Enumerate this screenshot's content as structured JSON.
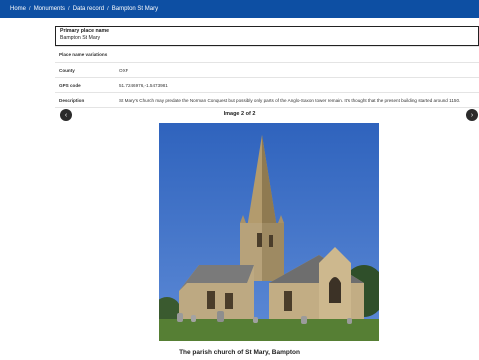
{
  "breadcrumb": {
    "items": [
      "Home",
      "Monuments",
      "Data record",
      "Bampton St Mary"
    ],
    "separator": "/"
  },
  "primary": {
    "label": "Primary place name",
    "value": "Bampton St Mary"
  },
  "rows": [
    {
      "key": "Place name variations",
      "value": ""
    },
    {
      "key": "County",
      "value": "OXF"
    },
    {
      "key": "GPS code",
      "value": "51.7246976,-1.5473981"
    },
    {
      "key": "Description",
      "value": "St Mary's Church may predate the Norman Conquest but possibly only parts of the Anglo-Saxon tower remain. It's thought that the present building started around 1150."
    }
  ],
  "gallery": {
    "counter": "Image 2 of 2",
    "prev_icon": "chevron-left-icon",
    "next_icon": "chevron-right-icon",
    "prev_glyph": "‹",
    "next_glyph": "›",
    "caption": "The parish church of St Mary, Bampton"
  },
  "colors": {
    "header": "#0d4fa3",
    "sky": "#3d6fc4",
    "stone": "#b9a57c",
    "roof": "#777777",
    "grass": "#5b8a3a"
  }
}
